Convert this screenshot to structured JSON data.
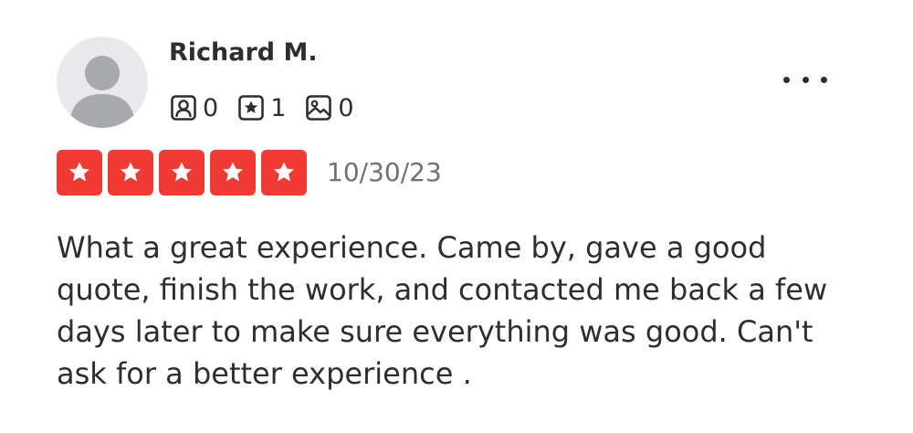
{
  "review": {
    "reviewer": {
      "name": "Richard M.",
      "avatar_icon": "default-user-avatar-icon"
    },
    "stats": {
      "friends": {
        "icon": "friends-icon",
        "count": "0"
      },
      "reviews": {
        "icon": "review-star-icon",
        "count": "1"
      },
      "photos": {
        "icon": "photo-icon",
        "count": "0"
      }
    },
    "menu_icon": "more-options-icon",
    "rating": {
      "value": 5,
      "max": 5,
      "star_color": "#ef3b34"
    },
    "date": "10/30/23",
    "text": "What a great experience. Came by, gave a good quote, finish the work, and contacted me back a few days later to make sure everything was good. Can't ask for a better experience ."
  }
}
